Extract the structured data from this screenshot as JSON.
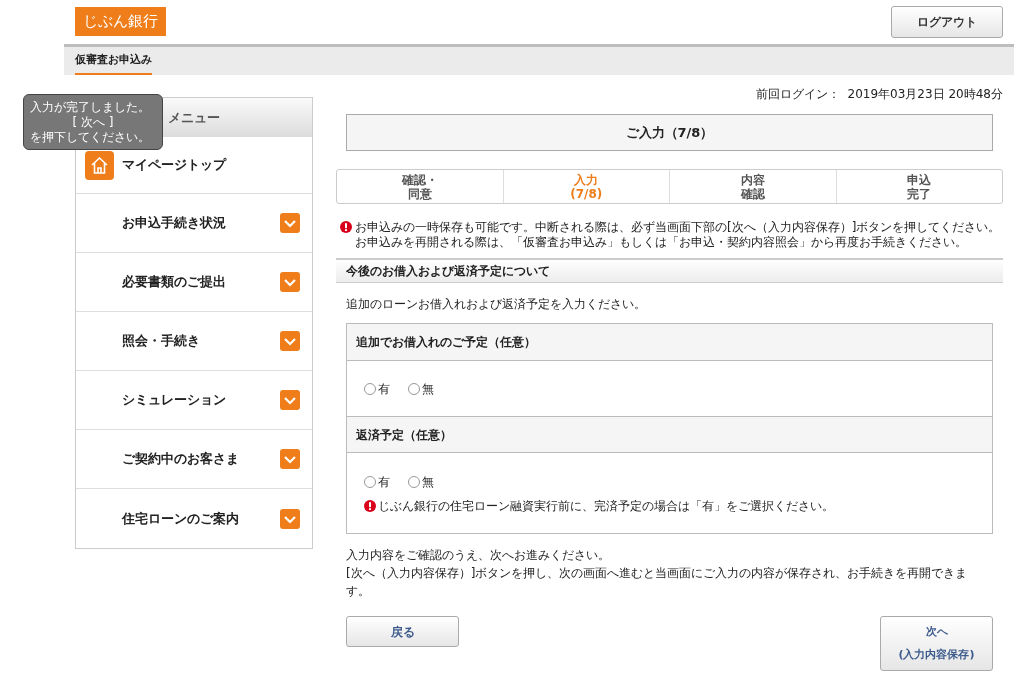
{
  "header": {
    "logo": "じぶん銀行",
    "logout_button": "ログアウト"
  },
  "nav": {
    "tabs": [
      {
        "label": "仮審査お申込み",
        "selected": true
      }
    ]
  },
  "tooltip": {
    "lines": [
      "入力が完了しました。",
      "[ 次へ ]",
      "を押下してください。"
    ]
  },
  "sidebar": {
    "title": "メニュー",
    "top_item": "マイページトップ",
    "items": [
      {
        "label": "お申込手続き状況",
        "expanded": false
      },
      {
        "label": "必要書類のご提出",
        "expanded": false
      },
      {
        "label": "照会・手続き",
        "expanded": false
      },
      {
        "label": "シミュレーション",
        "expanded": false
      },
      {
        "label": "ご契約中のお客さま",
        "expanded": false
      },
      {
        "label": "住宅ローンのご案内",
        "expanded": false
      }
    ]
  },
  "last_login": {
    "label": "前回ログイン：",
    "value": "2019年03月23日 20時48分"
  },
  "page_title": "ご入力（7/8）",
  "steps": [
    {
      "lines": [
        "確認・",
        "同意"
      ],
      "selected": false
    },
    {
      "lines": [
        "入力",
        "(7/8)"
      ],
      "selected": true
    },
    {
      "lines": [
        "内容",
        "確認"
      ],
      "selected": false
    },
    {
      "lines": [
        "申込",
        "完了"
      ],
      "selected": false
    }
  ],
  "notice": [
    "お申込みの一時保存も可能です。中断される際は、必ず当画面下部の[次へ（入力内容保存）]ボタンを押してください。",
    "お申込みを再開される際は、「仮審査お申込み」もしくは「お申込・契約内容照会」から再度お手続きください。"
  ],
  "section": {
    "title": "今後のお借入および返済予定について",
    "description": "追加のローンお借入れおよび返済予定を入力ください。",
    "questions": [
      {
        "label": "追加でお借入れのご予定（任意）",
        "options": [
          {
            "label": "有",
            "selected": false
          },
          {
            "label": "無",
            "selected": false
          }
        ]
      },
      {
        "label": "返済予定（任意）",
        "options": [
          {
            "label": "有",
            "selected": false
          },
          {
            "label": "無",
            "selected": false
          }
        ],
        "warning": "じぶん銀行の住宅ローン融資実行前に、完済予定の場合は「有」をご選択ください。"
      }
    ]
  },
  "footer_text": [
    "入力内容をご確認のうえ、次へお進みください。",
    "[次へ（入力内容保存）]ボタンを押し、次の画面へ進むと当画面にご入力の内容が保存され、お手続きを再開できます。"
  ],
  "buttons": {
    "back": "戻る",
    "next": [
      "次へ",
      "(入力内容保存)"
    ]
  }
}
